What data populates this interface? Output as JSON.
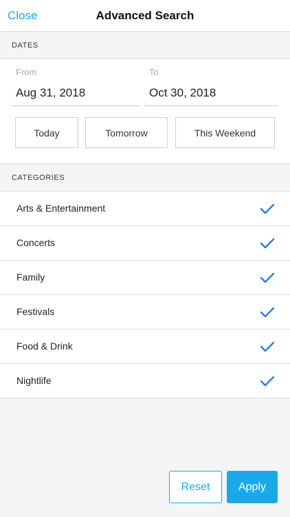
{
  "header": {
    "close_label": "Close",
    "title": "Advanced Search"
  },
  "dates": {
    "section_label": "DATES",
    "from_label": "From",
    "from_value": "Aug 31, 2018",
    "to_label": "To",
    "to_value": "Oct 30, 2018",
    "quick_buttons": [
      "Today",
      "Tomorrow",
      "This Weekend"
    ]
  },
  "categories": {
    "section_label": "CATEGORIES",
    "items": [
      {
        "label": "Arts & Entertainment",
        "checked": true
      },
      {
        "label": "Concerts",
        "checked": true
      },
      {
        "label": "Family",
        "checked": true
      },
      {
        "label": "Festivals",
        "checked": true
      },
      {
        "label": "Food & Drink",
        "checked": true
      },
      {
        "label": "Nightlife",
        "checked": true
      }
    ]
  },
  "footer": {
    "reset_label": "Reset",
    "apply_label": "Apply"
  },
  "colors": {
    "accent": "#1aa9e8",
    "check": "#2b7be0"
  }
}
